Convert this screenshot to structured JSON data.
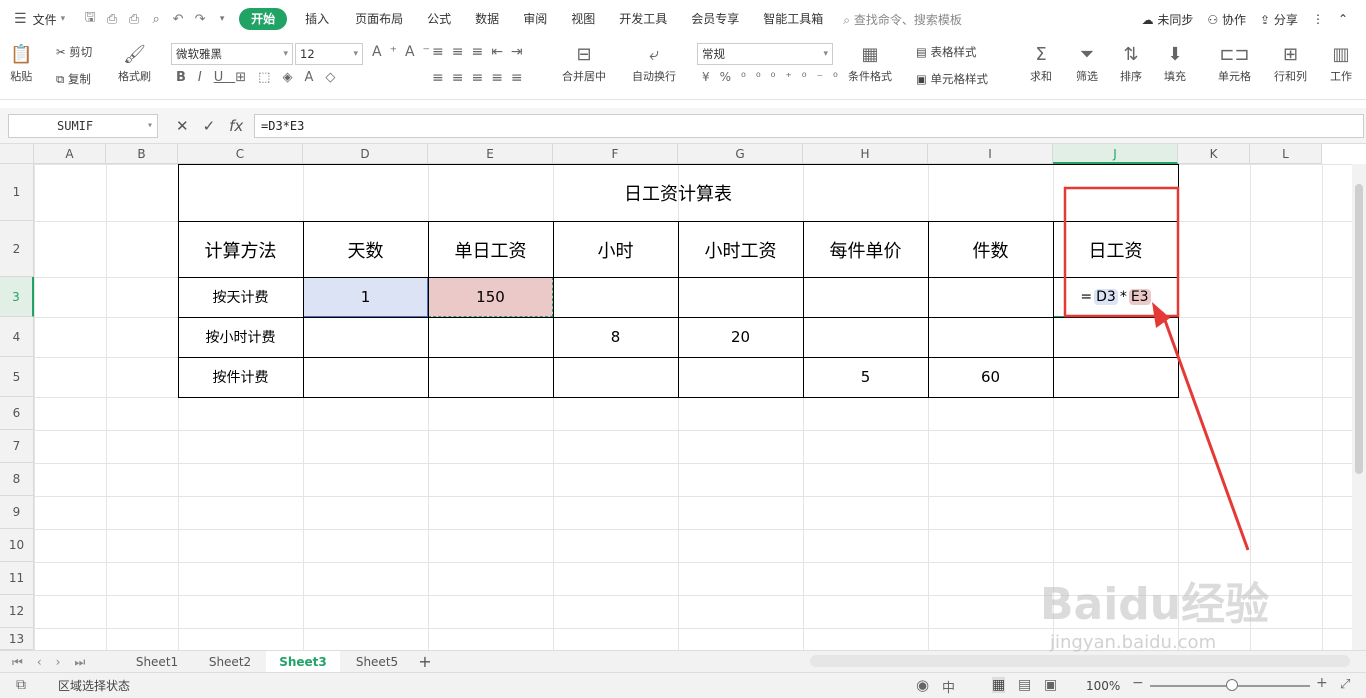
{
  "menubar": {
    "file": "文件",
    "tabs": [
      "开始",
      "插入",
      "页面布局",
      "公式",
      "数据",
      "审阅",
      "视图",
      "开发工具",
      "会员专享",
      "智能工具箱"
    ],
    "active_tab": "开始",
    "search": "查找命令、搜索模板",
    "right": [
      "未同步",
      "协作",
      "分享"
    ]
  },
  "ribbon": {
    "paste": "粘贴",
    "cut": "剪切",
    "copy": "复制",
    "format_painter": "格式刷",
    "font": "微软雅黑",
    "font_size": "12",
    "merge_center": "合并居中",
    "wrap_text": "自动换行",
    "number_format": "常规",
    "conditional_format": "条件格式",
    "table_style": "表格样式",
    "cell_style": "单元格样式",
    "sum": "求和",
    "filter": "筛选",
    "sort": "排序",
    "fill": "填充",
    "cell": "单元格",
    "row_col": "行和列",
    "worksheet": "工作"
  },
  "formula_bar": {
    "name_box": "SUMIF",
    "formula": "=D3*E3"
  },
  "grid": {
    "columns": [
      "A",
      "B",
      "C",
      "D",
      "E",
      "F",
      "G",
      "H",
      "I",
      "J",
      "K",
      "L"
    ],
    "rows": [
      "1",
      "2",
      "3",
      "4",
      "5",
      "6",
      "7",
      "8",
      "9",
      "10",
      "11",
      "12",
      "13"
    ],
    "selected_col": "J",
    "selected_row": "3"
  },
  "table": {
    "title": "日工资计算表",
    "headers": [
      "计算方法",
      "天数",
      "单日工资",
      "小时",
      "小时工资",
      "每件单价",
      "件数",
      "日工资"
    ],
    "rows": [
      [
        "按天计费",
        "1",
        "150",
        "",
        "",
        "",
        "",
        ""
      ],
      [
        "按小时计费",
        "",
        "",
        "8",
        "20",
        "",
        "",
        ""
      ],
      [
        "按件计费",
        "",
        "",
        "",
        "",
        "5",
        "60",
        ""
      ]
    ],
    "editing_formula": {
      "eq": "=",
      "ref1": "D3",
      "op": "*",
      "ref2": "E3"
    }
  },
  "sheets": {
    "tabs": [
      "Sheet1",
      "Sheet2",
      "Sheet3",
      "Sheet5"
    ],
    "active": "Sheet3"
  },
  "status": {
    "mode": "区域选择状态",
    "zoom": "100%"
  },
  "watermark": {
    "main": "Baidu经验",
    "url": "jingyan.baidu.com"
  },
  "colors": {
    "accent": "#21a366",
    "highlight_blue": "#dbe3f5",
    "highlight_red": "#ecc9c9",
    "annotation": "#e53935"
  }
}
